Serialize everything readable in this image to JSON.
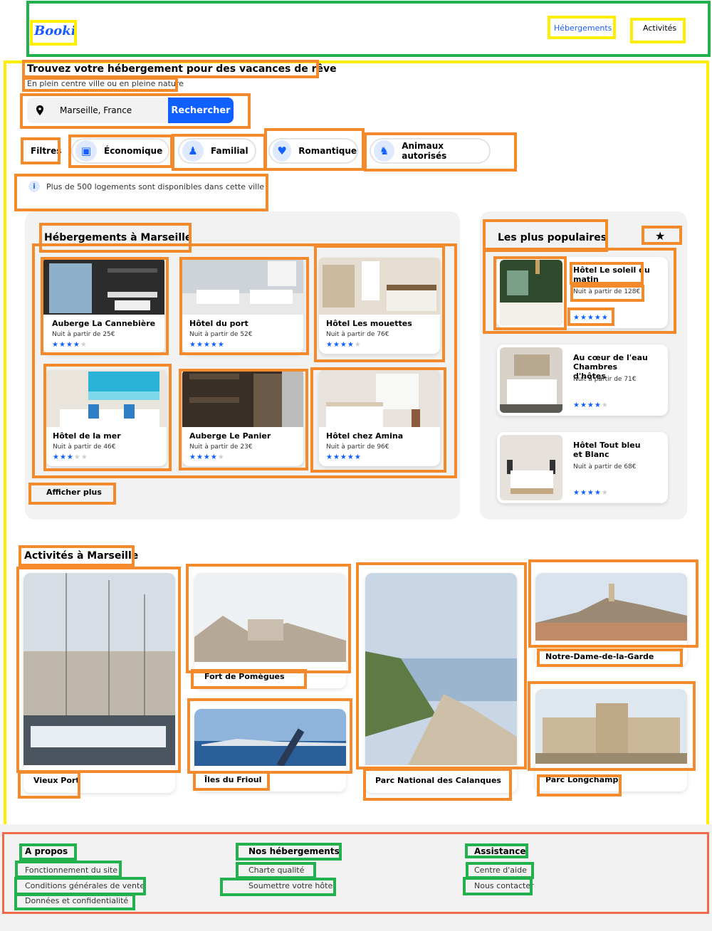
{
  "header": {
    "logo": "Booki",
    "nav": [
      {
        "label": "Hébergements"
      },
      {
        "label": "Activités"
      }
    ]
  },
  "hero": {
    "title": "Trouvez votre hébergement pour des vacances de rêve",
    "subtitle": "En plein centre ville ou en pleine nature",
    "search_value": "Marseille, France",
    "search_button": "Rechercher"
  },
  "filters": {
    "label": "Filtres",
    "chips": [
      {
        "label": "Économique",
        "icon": "money-icon"
      },
      {
        "label": "Familial",
        "icon": "person-icon"
      },
      {
        "label": "Romantique",
        "icon": "heart-icon"
      },
      {
        "label": "Animaux autorisés",
        "icon": "dog-icon"
      }
    ]
  },
  "info": "Plus de 500 logements sont disponibles dans cette ville",
  "lodgings": {
    "title": "Hébergements à Marseille",
    "items": [
      {
        "name": "Auberge La Cannebière",
        "price": "Nuit à partir de 25€",
        "rating": 4
      },
      {
        "name": "Hôtel du port",
        "price": "Nuit à partir de 52€",
        "rating": 5
      },
      {
        "name": "Hôtel Les mouettes",
        "price": "Nuit à partir de 76€",
        "rating": 4
      },
      {
        "name": "Hôtel de la mer",
        "price": "Nuit à partir de 46€",
        "rating": 3
      },
      {
        "name": "Auberge Le Panier",
        "price": "Nuit à partir de 23€",
        "rating": 4
      },
      {
        "name": "Hôtel chez Amina",
        "price": "Nuit à partir de 96€",
        "rating": 5
      }
    ],
    "more": "Afficher plus"
  },
  "popular": {
    "title": "Les plus populaires",
    "items": [
      {
        "name": "Hôtel Le soleil du matin",
        "price": "Nuit à partir de 128€",
        "rating": 5
      },
      {
        "name": "Au cœur de l'eau Chambres d'hôtes",
        "price": "Nuit à partir de 71€",
        "rating": 4
      },
      {
        "name": "Hôtel Tout bleu et Blanc",
        "price": "Nuit à partir de 68€",
        "rating": 4
      }
    ]
  },
  "activities": {
    "title": "Activités à Marseille",
    "items": [
      {
        "name": "Vieux Port"
      },
      {
        "name": "Fort de Pomègues"
      },
      {
        "name": "Îles du Frioul"
      },
      {
        "name": "Parc National des Calanques"
      },
      {
        "name": "Notre-Dame-de-la-Garde"
      },
      {
        "name": "Parc Longchamp"
      }
    ]
  },
  "footer": {
    "columns": [
      {
        "title": "A propos",
        "links": [
          "Fonctionnement du site",
          "Conditions générales de vente",
          "Données et confidentialité"
        ]
      },
      {
        "title": "Nos hébergements",
        "links": [
          "Charte qualité",
          "Soumettre votre hôtel"
        ]
      },
      {
        "title": "Assistance",
        "links": [
          "Centre d'aide",
          "Nous contacter"
        ]
      }
    ]
  },
  "colors": {
    "accent": "#1060ff",
    "panel": "#f2f2f2",
    "annotation_orange": "#f58a2c",
    "annotation_yellow": "#ffee00",
    "annotation_green": "#22b14c"
  }
}
